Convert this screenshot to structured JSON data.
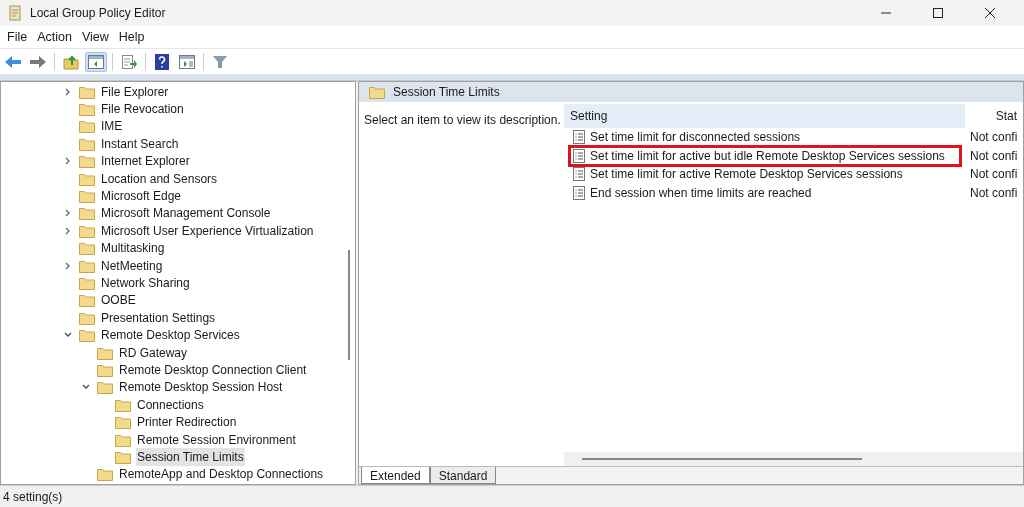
{
  "window": {
    "title": "Local Group Policy Editor"
  },
  "menu": [
    "File",
    "Action",
    "View",
    "Help"
  ],
  "toolbar": [
    {
      "kind": "back",
      "pressed": false
    },
    {
      "kind": "forward",
      "pressed": false
    },
    {
      "kind": "up",
      "pressed": false
    },
    {
      "kind": "tree",
      "pressed": true
    },
    {
      "kind": "export",
      "pressed": false
    },
    {
      "kind": "help",
      "pressed": false
    },
    {
      "kind": "view",
      "pressed": false
    },
    {
      "kind": "filter",
      "pressed": false
    }
  ],
  "tree": [
    {
      "label": "File Explorer",
      "expanded": false,
      "selected": false
    },
    {
      "label": "File Revocation",
      "selected": false
    },
    {
      "label": "IME",
      "selected": false
    },
    {
      "label": "Instant Search",
      "selected": false
    },
    {
      "label": "Internet Explorer",
      "expanded": false,
      "selected": false
    },
    {
      "label": "Location and Sensors",
      "selected": false
    },
    {
      "label": "Microsoft Edge",
      "selected": false
    },
    {
      "label": "Microsoft Management Console",
      "expanded": false,
      "selected": false
    },
    {
      "label": "Microsoft User Experience Virtualization",
      "expanded": false,
      "selected": false
    },
    {
      "label": "Multitasking",
      "selected": false
    },
    {
      "label": "NetMeeting",
      "expanded": false,
      "selected": false
    },
    {
      "label": "Network Sharing",
      "selected": false
    },
    {
      "label": "OOBE",
      "selected": false
    },
    {
      "label": "Presentation Settings",
      "selected": false
    },
    {
      "label": "Remote Desktop Services",
      "expanded": true,
      "selected": false,
      "children": [
        {
          "label": "RD Gateway",
          "selected": false
        },
        {
          "label": "Remote Desktop Connection Client",
          "selected": false
        },
        {
          "label": "Remote Desktop Session Host",
          "expanded": true,
          "selected": false,
          "children": [
            {
              "label": "Connections",
              "selected": false
            },
            {
              "label": "Printer Redirection",
              "selected": false
            },
            {
              "label": "Remote Session Environment",
              "selected": false
            },
            {
              "label": "Session Time Limits",
              "selected": true
            }
          ]
        },
        {
          "label": "RemoteApp and Desktop Connections",
          "selected": false
        }
      ]
    }
  ],
  "details": {
    "title": "Session Time Limits",
    "description": "Select an item to view its description.",
    "columns": [
      "Setting",
      "Stat"
    ],
    "rows": [
      {
        "setting": "Set time limit for disconnected sessions",
        "state": "Not confi",
        "highlighted": false
      },
      {
        "setting": "Set time limit for active but idle Remote Desktop Services sessions",
        "state": "Not confi",
        "highlighted": true
      },
      {
        "setting": "Set time limit for active Remote Desktop Services sessions",
        "state": "Not confi",
        "highlighted": false
      },
      {
        "setting": "End session when time limits are reached",
        "state": "Not confi",
        "highlighted": false
      }
    ]
  },
  "tabs": [
    {
      "label": "Extended",
      "selected": true
    },
    {
      "label": "Standard",
      "selected": false
    }
  ],
  "status_bar": "4 setting(s)"
}
